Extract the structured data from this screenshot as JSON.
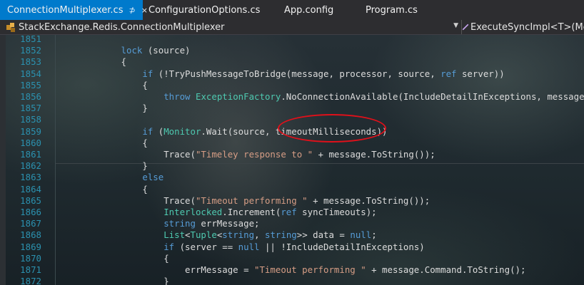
{
  "tabs": [
    {
      "label": "ConnectionMultiplexer.cs",
      "pin": "⊅",
      "close": "×"
    },
    {
      "label": "ConfigurationOptions.cs"
    },
    {
      "label": "App.config"
    },
    {
      "label": "Program.cs"
    }
  ],
  "navbar": {
    "type_dropdown": "StackExchange.Redis.ConnectionMultiplexer",
    "member_dropdown": "ExecuteSyncImpl<T>(Mes"
  },
  "colors": {
    "accent": "#007acc",
    "keyword": "#569cd6",
    "type": "#4ec9b0",
    "string": "#d69d85",
    "line_number": "#2b91af",
    "annotation": "#e0101a"
  },
  "code": {
    "lines": [
      {
        "n": "1851",
        "parts": [
          {
            "t": "",
            "c": "tx"
          }
        ]
      },
      {
        "n": "1852",
        "parts": [
          {
            "t": "            ",
            "c": "tx"
          },
          {
            "t": "lock",
            "c": "kw"
          },
          {
            "t": " (source)",
            "c": "tx"
          }
        ]
      },
      {
        "n": "1853",
        "parts": [
          {
            "t": "            {",
            "c": "tx"
          }
        ]
      },
      {
        "n": "1854",
        "parts": [
          {
            "t": "                ",
            "c": "tx"
          },
          {
            "t": "if",
            "c": "kw"
          },
          {
            "t": " (!TryPushMessageToBridge(message, processor, source, ",
            "c": "tx"
          },
          {
            "t": "ref",
            "c": "kw"
          },
          {
            "t": " server))",
            "c": "tx"
          }
        ]
      },
      {
        "n": "1855",
        "parts": [
          {
            "t": "                {",
            "c": "tx"
          }
        ]
      },
      {
        "n": "1856",
        "parts": [
          {
            "t": "                    ",
            "c": "tx"
          },
          {
            "t": "throw",
            "c": "kw"
          },
          {
            "t": " ",
            "c": "tx"
          },
          {
            "t": "ExceptionFactory",
            "c": "ty"
          },
          {
            "t": ".NoConnectionAvailable(IncludeDetailInExceptions, message.Co",
            "c": "tx"
          }
        ]
      },
      {
        "n": "1857",
        "parts": [
          {
            "t": "                }",
            "c": "tx"
          }
        ]
      },
      {
        "n": "1858",
        "parts": [
          {
            "t": "",
            "c": "tx"
          }
        ]
      },
      {
        "n": "1859",
        "parts": [
          {
            "t": "                ",
            "c": "tx"
          },
          {
            "t": "if",
            "c": "kw"
          },
          {
            "t": " (",
            "c": "tx"
          },
          {
            "t": "Monitor",
            "c": "ty"
          },
          {
            "t": ".Wait(source, timeoutMilliseconds))",
            "c": "tx"
          }
        ]
      },
      {
        "n": "1860",
        "parts": [
          {
            "t": "                {",
            "c": "tx"
          }
        ]
      },
      {
        "n": "1861",
        "parts": [
          {
            "t": "                    Trace(",
            "c": "tx"
          },
          {
            "t": "\"Timeley response to \"",
            "c": "st"
          },
          {
            "t": " + message.ToString());",
            "c": "tx"
          }
        ]
      },
      {
        "n": "1862",
        "parts": [
          {
            "t": "                }",
            "c": "tx"
          }
        ]
      },
      {
        "n": "1863",
        "parts": [
          {
            "t": "                ",
            "c": "tx"
          },
          {
            "t": "else",
            "c": "kw"
          }
        ]
      },
      {
        "n": "1864",
        "parts": [
          {
            "t": "                {",
            "c": "tx"
          }
        ]
      },
      {
        "n": "1865",
        "parts": [
          {
            "t": "                    Trace(",
            "c": "tx"
          },
          {
            "t": "\"Timeout performing \"",
            "c": "st"
          },
          {
            "t": " + message.ToString());",
            "c": "tx"
          }
        ]
      },
      {
        "n": "1866",
        "parts": [
          {
            "t": "                    ",
            "c": "tx"
          },
          {
            "t": "Interlocked",
            "c": "ty"
          },
          {
            "t": ".Increment(",
            "c": "tx"
          },
          {
            "t": "ref",
            "c": "kw"
          },
          {
            "t": " syncTimeouts);",
            "c": "tx"
          }
        ]
      },
      {
        "n": "1867",
        "parts": [
          {
            "t": "                    ",
            "c": "tx"
          },
          {
            "t": "string",
            "c": "kw"
          },
          {
            "t": " errMessage;",
            "c": "tx"
          }
        ]
      },
      {
        "n": "1868",
        "parts": [
          {
            "t": "                    ",
            "c": "tx"
          },
          {
            "t": "List",
            "c": "ty"
          },
          {
            "t": "<",
            "c": "tx"
          },
          {
            "t": "Tuple",
            "c": "ty"
          },
          {
            "t": "<",
            "c": "tx"
          },
          {
            "t": "string",
            "c": "kw"
          },
          {
            "t": ", ",
            "c": "tx"
          },
          {
            "t": "string",
            "c": "kw"
          },
          {
            "t": ">> data = ",
            "c": "tx"
          },
          {
            "t": "null",
            "c": "kw"
          },
          {
            "t": ";",
            "c": "tx"
          }
        ]
      },
      {
        "n": "1869",
        "parts": [
          {
            "t": "                    ",
            "c": "tx"
          },
          {
            "t": "if",
            "c": "kw"
          },
          {
            "t": " (server == ",
            "c": "tx"
          },
          {
            "t": "null",
            "c": "kw"
          },
          {
            "t": " || !IncludeDetailInExceptions)",
            "c": "tx"
          }
        ]
      },
      {
        "n": "1870",
        "parts": [
          {
            "t": "                    {",
            "c": "tx"
          }
        ]
      },
      {
        "n": "1871",
        "parts": [
          {
            "t": "                        errMessage = ",
            "c": "tx"
          },
          {
            "t": "\"Timeout performing \"",
            "c": "st"
          },
          {
            "t": " + message.Command.ToString();",
            "c": "tx"
          }
        ]
      },
      {
        "n": "1872",
        "parts": [
          {
            "t": "                    }",
            "c": "tx"
          }
        ]
      }
    ]
  }
}
